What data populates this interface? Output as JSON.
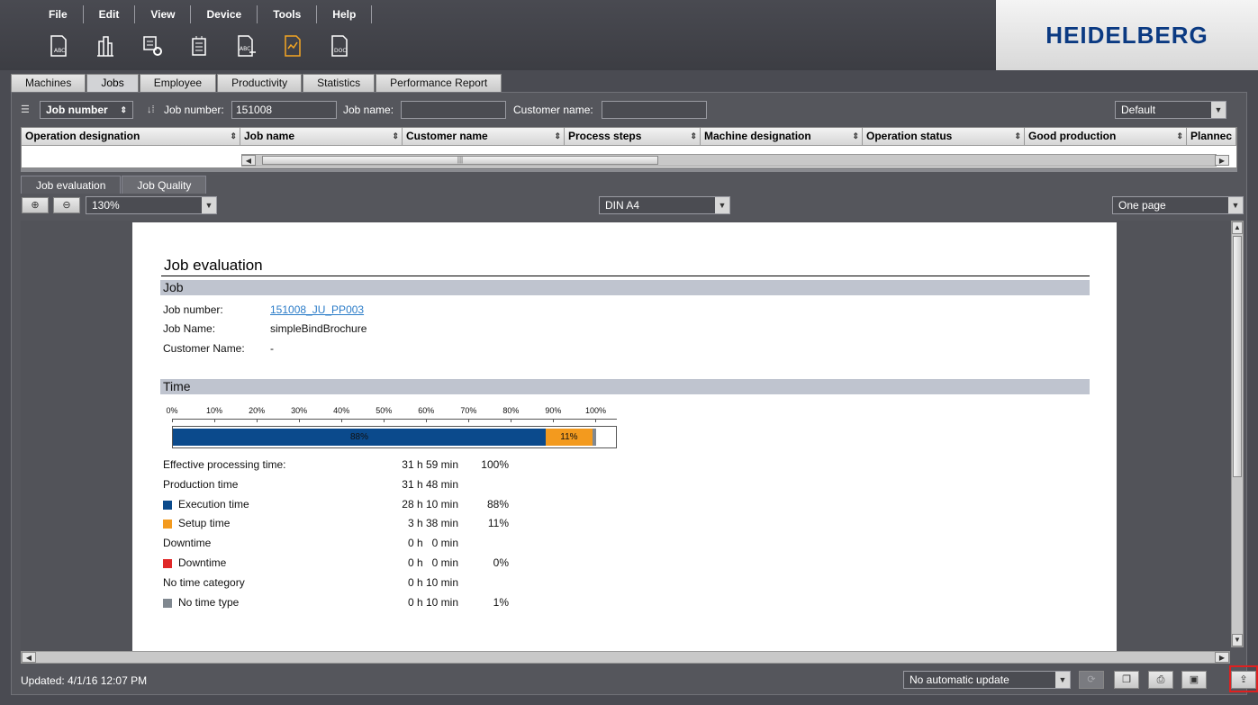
{
  "menu": [
    "File",
    "Edit",
    "View",
    "Device",
    "Tools",
    "Help"
  ],
  "toolbar_icons": [
    "job-report-icon",
    "machine-report-icon",
    "settings-report-icon",
    "device-report-icon",
    "arrow-report-icon",
    "evaluation-report-icon",
    "doc-report-icon"
  ],
  "brand": {
    "name": "HEIDELBERG"
  },
  "main_tabs": [
    "Machines",
    "Jobs",
    "Employee",
    "Productivity",
    "Statistics",
    "Performance Report"
  ],
  "active_main_tab": "Jobs",
  "filter": {
    "search_by": "Job number",
    "job_number_label": "Job number:",
    "job_number_value": "151008",
    "job_name_label": "Job name:",
    "job_name_value": "",
    "customer_name_label": "Customer name:",
    "customer_name_value": "",
    "profile": "Default"
  },
  "grid": {
    "columns": [
      "Operation designation",
      "Job name",
      "Customer name",
      "Process steps",
      "Machine designation",
      "Operation status",
      "Good production",
      "Plannec"
    ]
  },
  "sub_tabs": [
    "Job evaluation",
    "Job Quality"
  ],
  "preview": {
    "zoom": "130%",
    "paper": "DIN A4",
    "page_mode": "One page"
  },
  "report": {
    "title": "Job evaluation",
    "job_section": "Job",
    "job_number_label": "Job number:",
    "job_number_value": "151008_JU_PP003",
    "job_name_label": "Job Name:",
    "job_name_value": "simpleBindBrochure",
    "customer_label": "Customer Name:",
    "customer_value": "-",
    "time_section": "Time",
    "rows": [
      {
        "label": "Effective processing time:",
        "duration": "31 h 59 min",
        "percent": "100%",
        "legend": ""
      },
      {
        "label": "Production time",
        "duration": "31 h 48 min",
        "percent": "",
        "legend": ""
      },
      {
        "label": "Execution time",
        "duration": "28 h 10 min",
        "percent": "88%",
        "legend": "#0b4a8c"
      },
      {
        "label": "Setup time",
        "duration": "3 h 38 min",
        "percent": "11%",
        "legend": "#f39a1e"
      },
      {
        "label": "Downtime",
        "duration": "0 h   0 min",
        "percent": "",
        "legend": ""
      },
      {
        "label": "Downtime",
        "duration": "0 h   0 min",
        "percent": "0%",
        "legend": "#e02828"
      },
      {
        "label": "No time category",
        "duration": "0 h 10 min",
        "percent": "",
        "legend": ""
      },
      {
        "label": "No time type",
        "duration": "0 h 10 min",
        "percent": "1%",
        "legend": "#808890"
      }
    ]
  },
  "chart_data": {
    "type": "bar",
    "orientation": "horizontal-stacked",
    "categories": [
      "Time"
    ],
    "series": [
      {
        "name": "Execution time",
        "values": [
          88
        ],
        "label": "88%",
        "color": "#0b4a8c"
      },
      {
        "name": "Setup time",
        "values": [
          11
        ],
        "label": "11%",
        "color": "#f39a1e"
      },
      {
        "name": "No time type",
        "values": [
          1
        ],
        "label": "",
        "color": "#808890"
      }
    ],
    "x_ticks": [
      "0%",
      "10%",
      "20%",
      "30%",
      "40%",
      "50%",
      "60%",
      "70%",
      "80%",
      "90%",
      "100%"
    ],
    "xlim": [
      0,
      105
    ],
    "grid": false
  },
  "status": {
    "updated": "Updated: 4/1/16 12:07 PM",
    "auto_update": "No automatic update"
  }
}
